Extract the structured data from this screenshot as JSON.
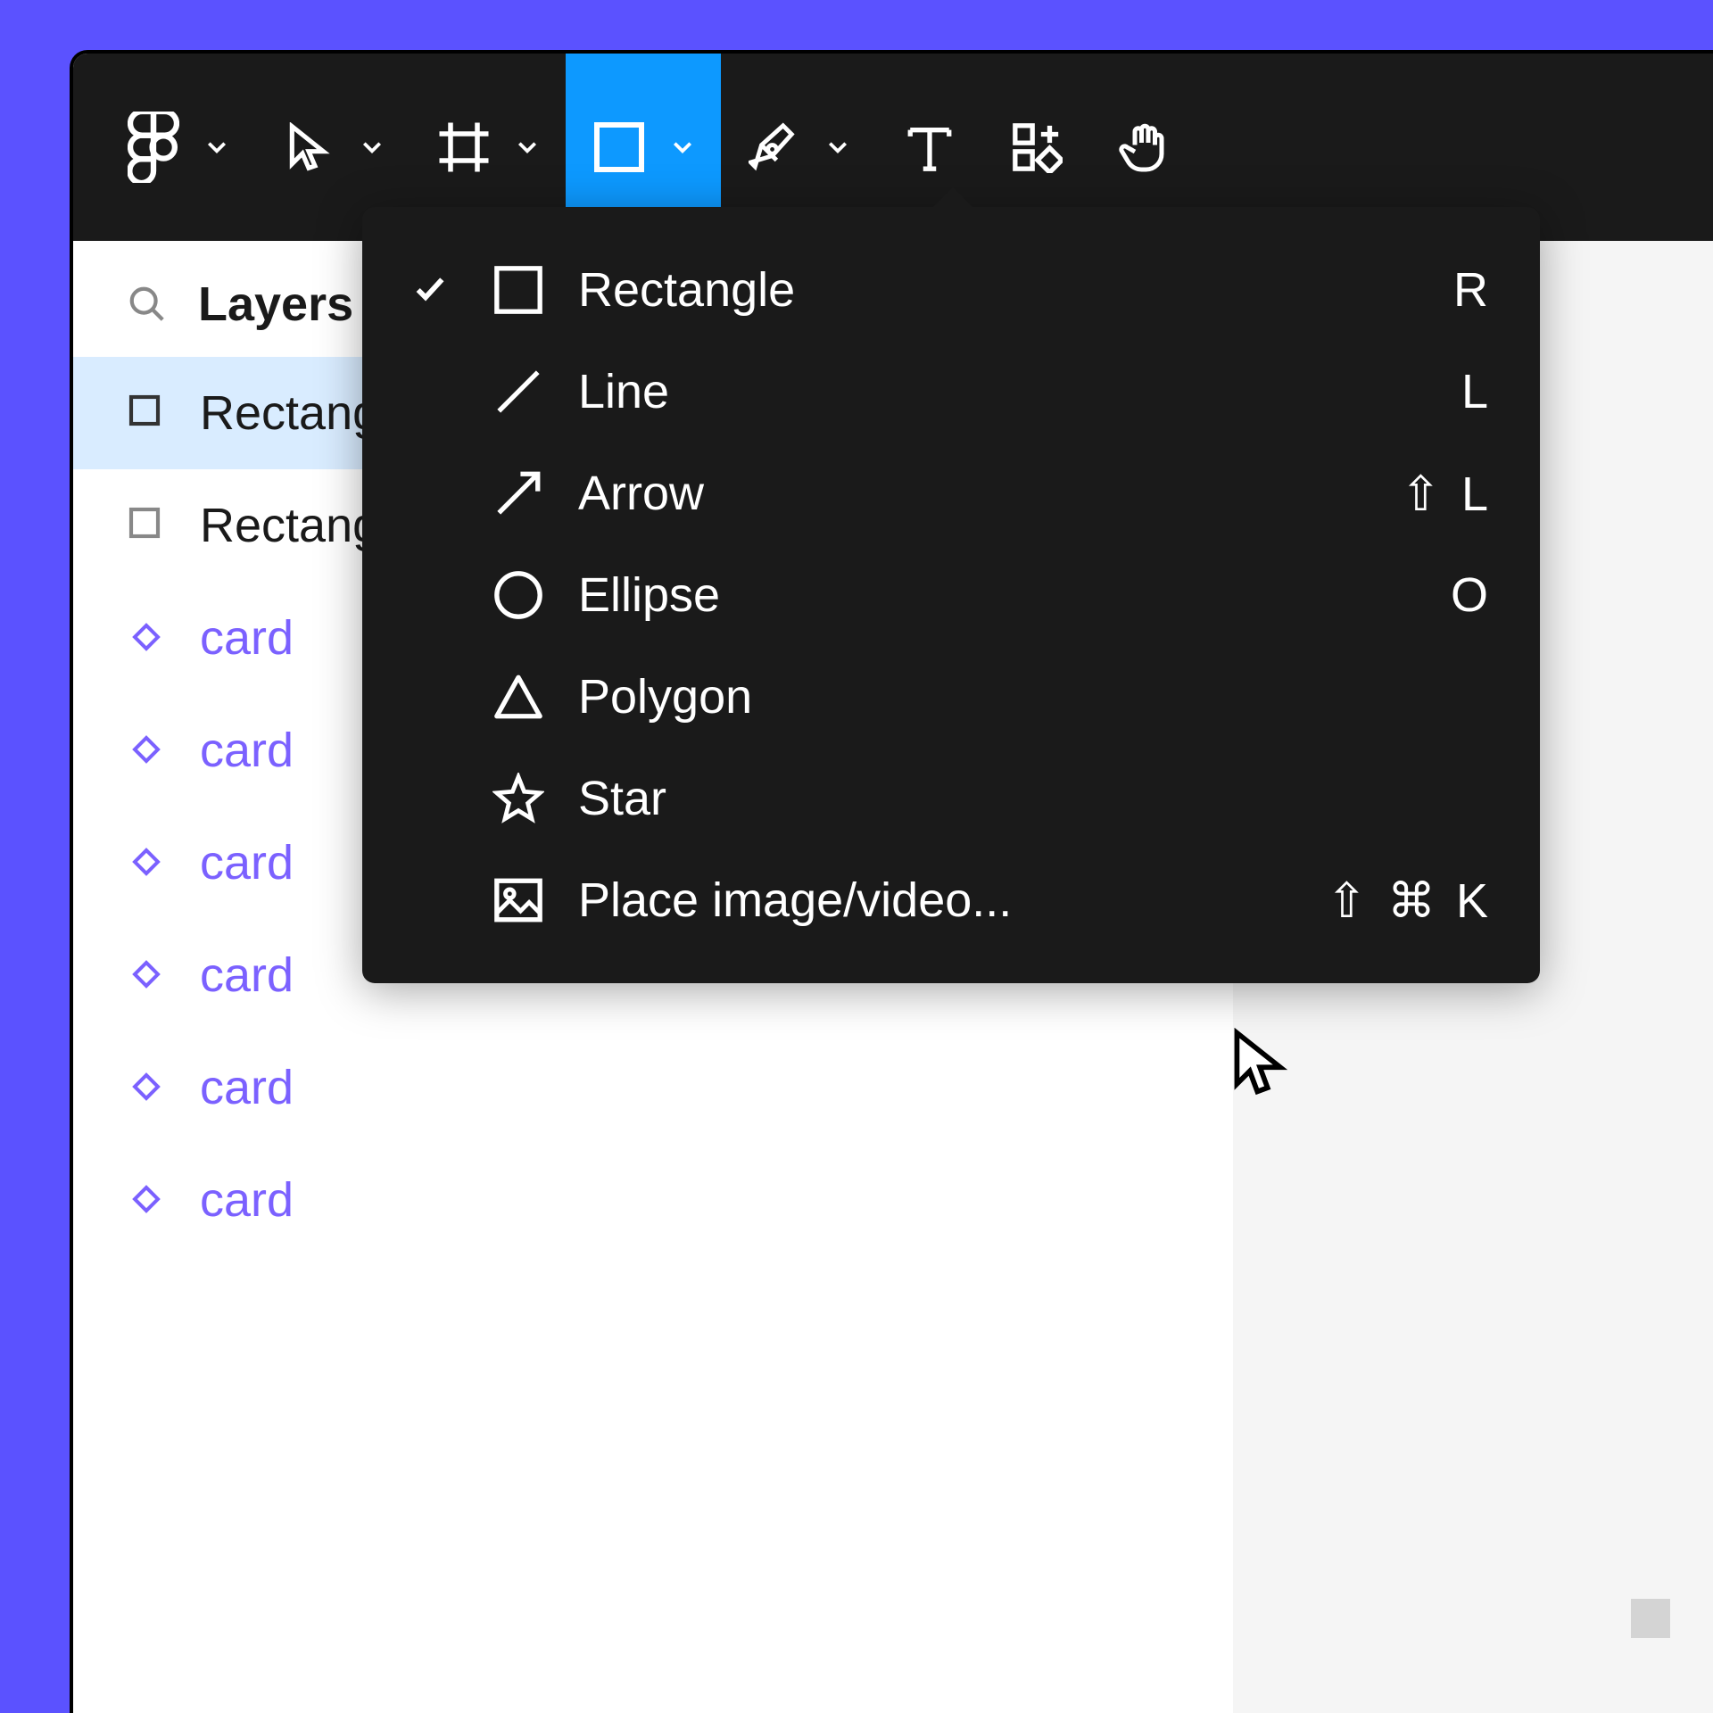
{
  "toolbar": {
    "active_tool": "shape"
  },
  "sidebar": {
    "search_label": "Layers",
    "layers": [
      {
        "label": "Rectangle",
        "type": "rect",
        "selected": true
      },
      {
        "label": "Rectangle",
        "type": "rect",
        "selected": false
      },
      {
        "label": "card",
        "type": "component",
        "selected": false
      },
      {
        "label": "card",
        "type": "component",
        "selected": false
      },
      {
        "label": "card",
        "type": "component",
        "selected": false
      },
      {
        "label": "card",
        "type": "component",
        "selected": false
      },
      {
        "label": "card",
        "type": "component",
        "selected": false
      },
      {
        "label": "card",
        "type": "component",
        "selected": false
      }
    ]
  },
  "dropdown": {
    "items": [
      {
        "label": "Rectangle",
        "shortcut": "R",
        "checked": true,
        "icon": "rectangle"
      },
      {
        "label": "Line",
        "shortcut": "L",
        "checked": false,
        "icon": "line"
      },
      {
        "label": "Arrow",
        "shortcut": "⇧ L",
        "checked": false,
        "icon": "arrow"
      },
      {
        "label": "Ellipse",
        "shortcut": "O",
        "checked": false,
        "icon": "ellipse"
      },
      {
        "label": "Polygon",
        "shortcut": "",
        "checked": false,
        "icon": "polygon"
      },
      {
        "label": "Star",
        "shortcut": "",
        "checked": false,
        "icon": "star"
      },
      {
        "label": "Place image/video...",
        "shortcut": "⇧ ⌘ K",
        "checked": false,
        "icon": "image"
      }
    ]
  }
}
